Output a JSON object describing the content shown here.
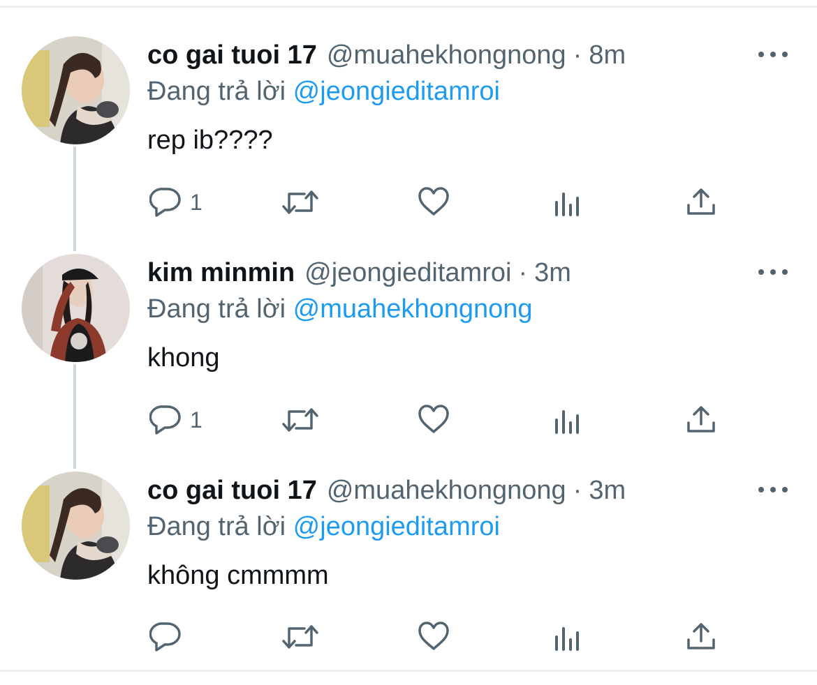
{
  "tweets": [
    {
      "name": "co gai tuoi 17",
      "handle": "@muahekhongnong",
      "time": "8m",
      "reply_prefix": "Đang trả lời",
      "reply_to": "@jeongieditamroi",
      "text": "rep ib????",
      "reply_count": "1"
    },
    {
      "name": "kim minmin",
      "handle": "@jeongieditamroi",
      "time": "3m",
      "reply_prefix": "Đang trả lời",
      "reply_to": "@muahekhongnong",
      "text": "khong",
      "reply_count": "1"
    },
    {
      "name": "co gai tuoi 17",
      "handle": "@muahekhongnong",
      "time": "3m",
      "reply_prefix": "Đang trả lời",
      "reply_to": "@jeongieditamroi",
      "text": "không cmmmm",
      "reply_count": ""
    }
  ],
  "separator": "·",
  "icons": {
    "reply": "reply-icon",
    "retweet": "retweet-icon",
    "like": "heart-icon",
    "views": "analytics-icon",
    "share": "share-icon",
    "more": "more-icon"
  },
  "colors": {
    "text": "#0f1419",
    "secondary": "#536471",
    "link": "#1d9bf0",
    "thread_line": "#cfd9de"
  }
}
